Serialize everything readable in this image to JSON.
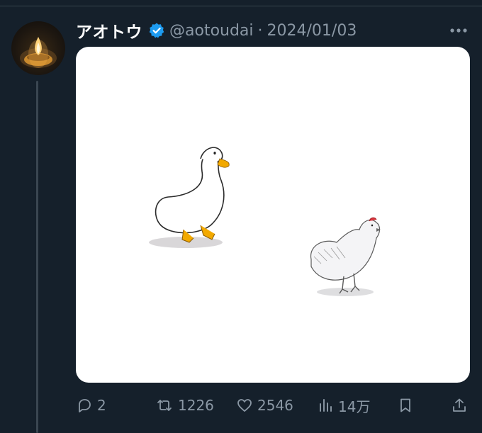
{
  "tweet": {
    "author": {
      "display_name": "アオトウ",
      "handle": "@aotoudai",
      "verified": true,
      "avatar_icon": "oil-lamp-avatar"
    },
    "separator": "·",
    "date": "2024/01/03",
    "media": {
      "description_icons": [
        "duck-illustration",
        "chicken-illustration"
      ]
    },
    "actions": {
      "replies": "2",
      "retweets": "1226",
      "likes": "2546",
      "views": "14万"
    }
  },
  "colors": {
    "background": "#15202b",
    "verified_blue": "#1d9bf0",
    "muted_text": "#8b98a5",
    "primary_text": "#e7e9ea"
  }
}
